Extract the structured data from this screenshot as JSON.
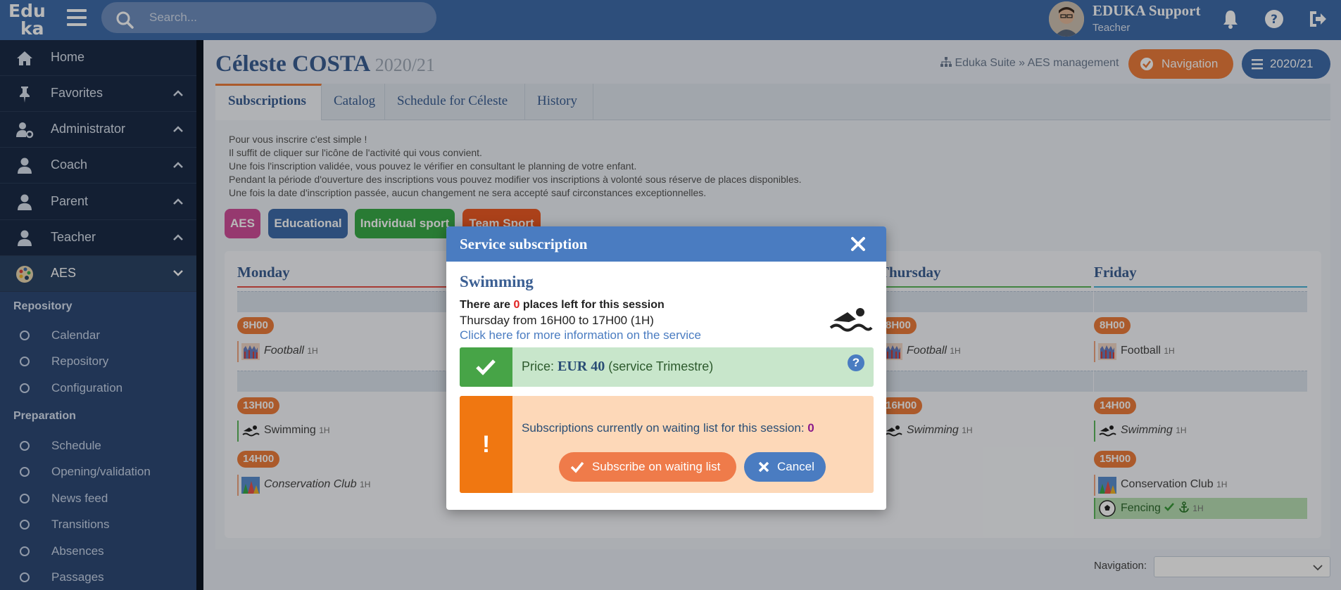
{
  "app": {
    "logo_line1": "Edu",
    "logo_line2": "ka",
    "search_placeholder": "Search..."
  },
  "user": {
    "name": "EDUKA Support",
    "role": "Teacher"
  },
  "sidebar": {
    "items": [
      {
        "label": "Home",
        "icon": "home-icon"
      },
      {
        "label": "Favorites",
        "icon": "pin-icon"
      },
      {
        "label": "Administrator",
        "icon": "user-cog-icon"
      },
      {
        "label": "Coach",
        "icon": "user-icon"
      },
      {
        "label": "Parent",
        "icon": "user-icon"
      },
      {
        "label": "Teacher",
        "icon": "user-icon"
      },
      {
        "label": "AES",
        "icon": "palette-icon"
      }
    ],
    "sections": [
      {
        "title": "Repository",
        "items": [
          "Calendar",
          "Repository",
          "Configuration"
        ]
      },
      {
        "title": "Preparation",
        "items": [
          "Schedule",
          "Opening/validation",
          "News feed",
          "Transitions",
          "Absences",
          "Passages"
        ]
      }
    ]
  },
  "page": {
    "title": "Céleste COSTA",
    "year": "2020/21",
    "breadcrumb": "Eduka Suite » AES management",
    "nav_button": "Navigation",
    "year_button": "2020/21"
  },
  "tabs": [
    "Subscriptions",
    "Catalog",
    "Schedule for Céleste",
    "History"
  ],
  "info_lines": [
    "Pour vous inscrire c'est simple !",
    "Il suffit de cliquer sur l'icône de l'activité qui vous convient.",
    "Une fois l'inscription validée, vous pouvez le vérifier en consultant le planning de votre enfant.",
    "Pendant la période d'ouverture des inscriptions vous pouvez modifier vos inscriptions à volonté sous réserve de places disponibles.",
    "Une fois la date d'inscription passée, aucun changement ne sera accepté sauf circonstances exceptionnelles."
  ],
  "categories": [
    {
      "label": "AES",
      "color": "#d04f9a"
    },
    {
      "label": "Educational",
      "color": "#3f6cab"
    },
    {
      "label": "Individual sport",
      "color": "#3aab49"
    },
    {
      "label": "Team Sport",
      "color": "#ee5a24"
    }
  ],
  "calendar": {
    "monday": {
      "title": "Monday",
      "slots": [
        {
          "time": "8H00",
          "activity": "Football",
          "duration": "1H"
        },
        {
          "time": "13H00",
          "activity": "Swimming",
          "duration": "1H"
        },
        {
          "time": "14H00",
          "activity": "Conservation Club",
          "duration": "1H"
        }
      ]
    },
    "thursday": {
      "title": "Thursday",
      "slots": [
        {
          "time": "8H00",
          "activity": "Football",
          "duration": "1H"
        },
        {
          "time": "16H00",
          "activity": "Swimming",
          "duration": "1H"
        }
      ]
    },
    "friday": {
      "title": "Friday",
      "slots": [
        {
          "time": "8H00",
          "activity": "Football",
          "duration": "1H"
        },
        {
          "time": "14H00",
          "activity": "Swimming",
          "duration": "1H"
        },
        {
          "time": "15H00",
          "activity": "Conservation Club",
          "duration": "1H"
        },
        {
          "time": "",
          "activity": "Fencing",
          "duration": "1H"
        }
      ]
    }
  },
  "modal": {
    "title": "Service subscription",
    "service": "Swimming",
    "places_prefix": "There are ",
    "places_count": "0",
    "places_suffix": " places left for this session",
    "when": "Thursday from 16H00 to 17H00 (1H)",
    "more_info": "Click here for more information on the service",
    "price_label": "Price: ",
    "price_value": "EUR 40",
    "price_note": " (service Trimestre)",
    "waiting_text": "Subscriptions currently on waiting list for this session: ",
    "waiting_count": "0",
    "subscribe_button": "Subscribe on waiting list",
    "cancel_button": "Cancel"
  },
  "footer": {
    "navigation_label": "Navigation:"
  },
  "colors": {
    "brand": "#3f6cab",
    "accent": "#ee7d3c",
    "sidebar": "#1b2c47"
  }
}
